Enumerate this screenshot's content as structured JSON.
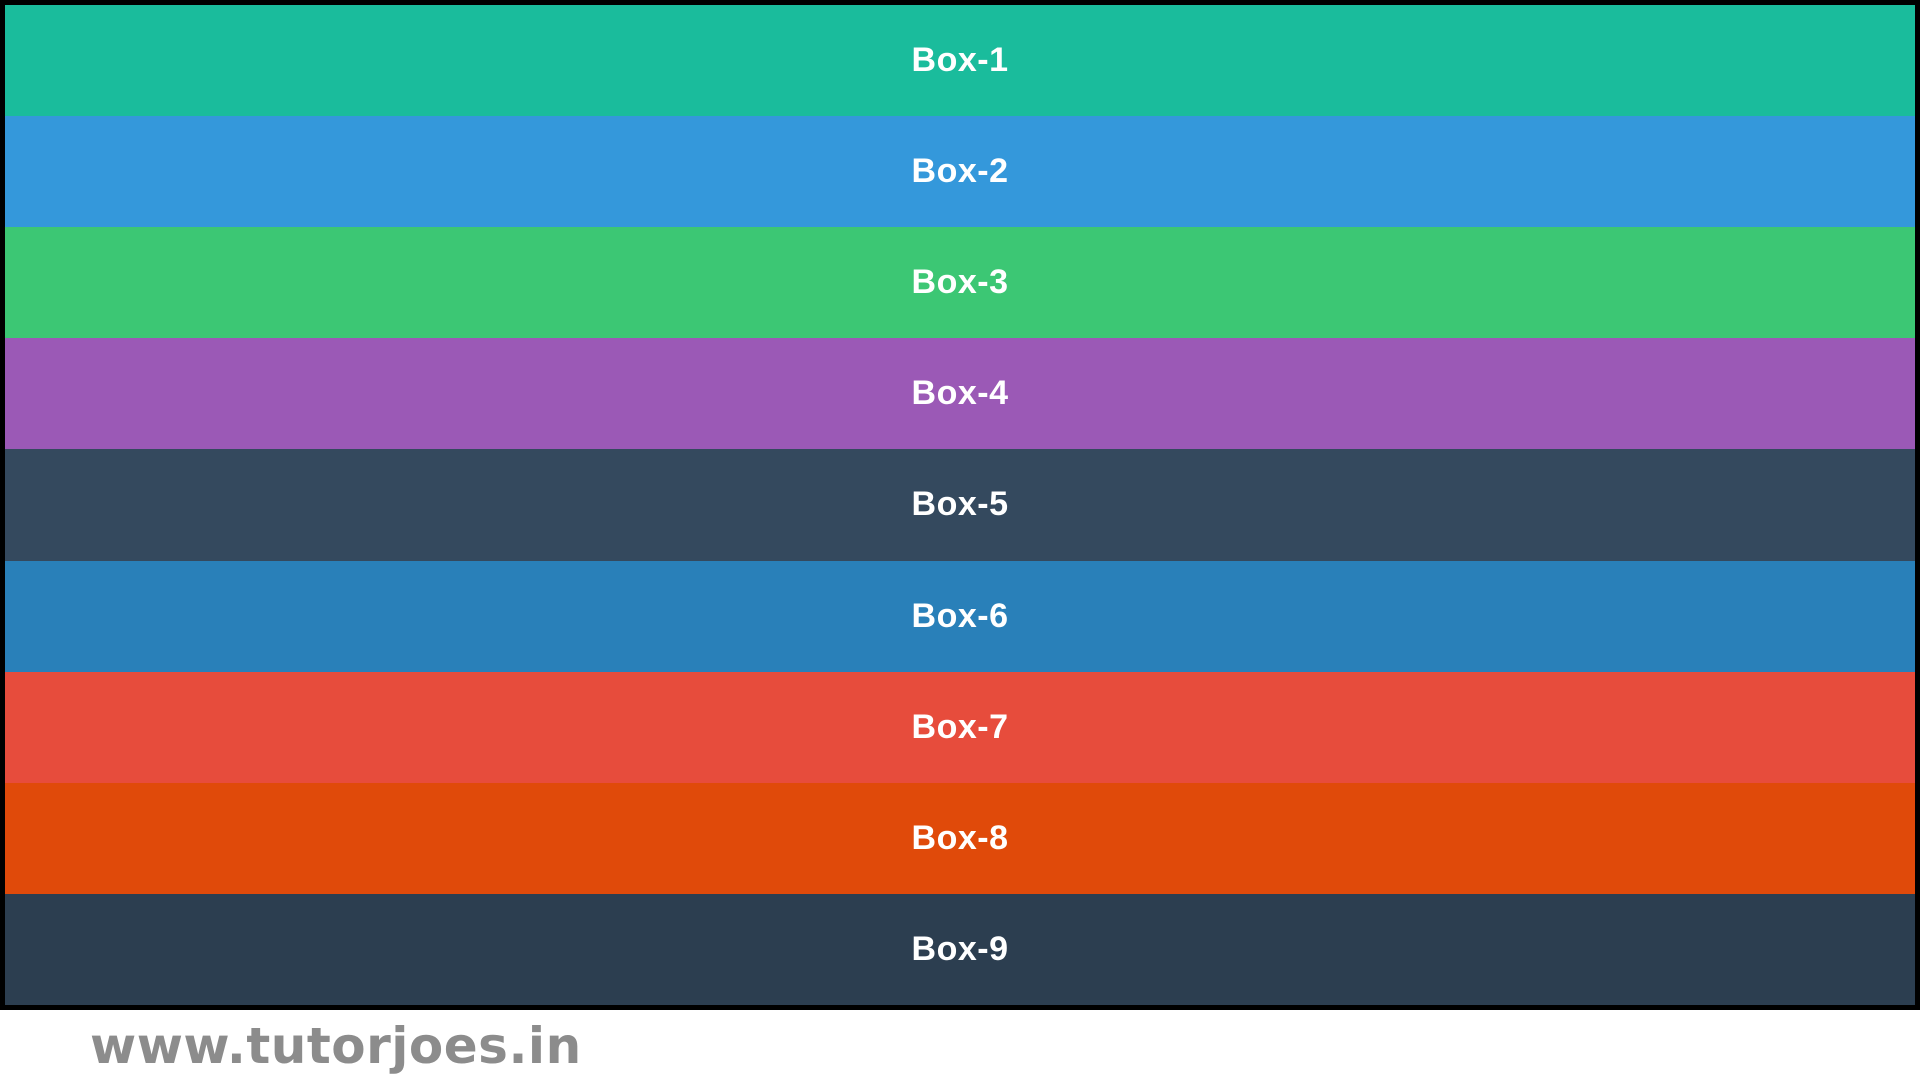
{
  "boxes": [
    {
      "label": "Box-1",
      "color": "#1abc9c"
    },
    {
      "label": "Box-2",
      "color": "#3498db"
    },
    {
      "label": "Box-3",
      "color": "#3cc774"
    },
    {
      "label": "Box-4",
      "color": "#9b59b6"
    },
    {
      "label": "Box-5",
      "color": "#34495e"
    },
    {
      "label": "Box-6",
      "color": "#2980b9"
    },
    {
      "label": "Box-7",
      "color": "#e74c3c"
    },
    {
      "label": "Box-8",
      "color": "#e04a0a"
    },
    {
      "label": "Box-9",
      "color": "#2c3e50"
    }
  ],
  "watermark": {
    "text": "www.tutorjoes.in",
    "color": "#8c8c8c"
  },
  "colors": {
    "frame": "#000000",
    "background": "#ffffff",
    "box_text": "#ffffff"
  }
}
